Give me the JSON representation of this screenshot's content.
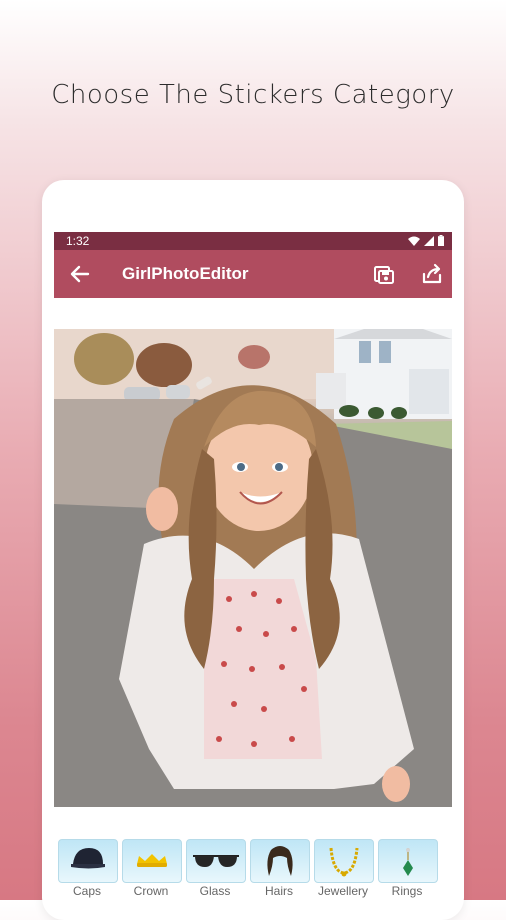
{
  "headline": "Choose The Stickers Category",
  "status_bar": {
    "time": "1:32"
  },
  "app_bar": {
    "title": "GirlPhotoEditor",
    "back_icon": "arrow-left-icon",
    "save_icon": "save-icon",
    "share_icon": "share-icon"
  },
  "photo": {
    "subject": "girl-photo"
  },
  "categories": [
    {
      "label": "Caps",
      "icon": "cap-icon"
    },
    {
      "label": "Crown",
      "icon": "crown-icon"
    },
    {
      "label": "Glass",
      "icon": "sunglasses-icon"
    },
    {
      "label": "Hairs",
      "icon": "hair-icon"
    },
    {
      "label": "Jewellery",
      "icon": "necklace-icon"
    },
    {
      "label": "Rings",
      "icon": "ring-icon"
    }
  ],
  "colors": {
    "status_bar": "#7a2e42",
    "app_bar": "#b04c5f",
    "thumb_tile": "#bfe6f6"
  }
}
